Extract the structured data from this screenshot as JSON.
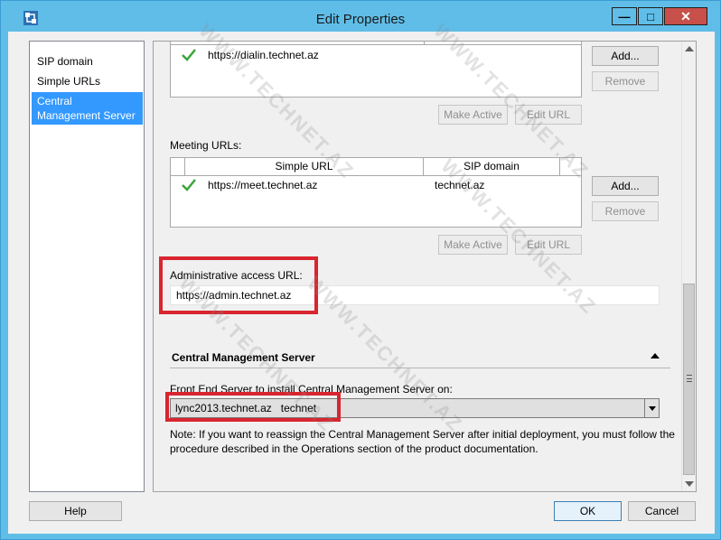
{
  "window": {
    "title": "Edit Properties",
    "minimize_glyph": "—",
    "maximize_glyph": "□",
    "close_glyph": "✕"
  },
  "nav": {
    "items": [
      {
        "label": "SIP domain"
      },
      {
        "label": "Simple URLs"
      },
      {
        "label": "Central Management Server",
        "selected": true
      }
    ]
  },
  "dialin": {
    "rows": [
      {
        "simple_url": "https://dialin.technet.az",
        "sip_domain": ""
      }
    ],
    "add_label": "Add...",
    "remove_label": "Remove",
    "make_active_label": "Make Active",
    "edit_url_label": "Edit URL"
  },
  "meeting": {
    "label": "Meeting URLs:",
    "columns": [
      "Simple URL",
      "SIP domain"
    ],
    "rows": [
      {
        "simple_url": "https://meet.technet.az",
        "sip_domain": "technet.az"
      }
    ],
    "add_label": "Add...",
    "remove_label": "Remove",
    "make_active_label": "Make Active",
    "edit_url_label": "Edit URL"
  },
  "admin": {
    "label": "Administrative access URL:",
    "value": "https://admin.technet.az"
  },
  "cms": {
    "section_title": "Central Management Server",
    "front_end_label": "Front End Server to install Central Management Server on:",
    "front_end_value": "lync2013.technet.az   technet",
    "note": "Note: If you want to reassign the Central Management Server after initial deployment, you must follow the procedure described in the Operations section of the product documentation."
  },
  "footer": {
    "help_label": "Help",
    "ok_label": "OK",
    "cancel_label": "Cancel"
  },
  "watermark": "WWW.TECHNET.AZ",
  "colors": {
    "titlebar": "#60bde8",
    "selection": "#3399ff",
    "highlight_border": "#d9252f",
    "check": "#3aa53a"
  }
}
